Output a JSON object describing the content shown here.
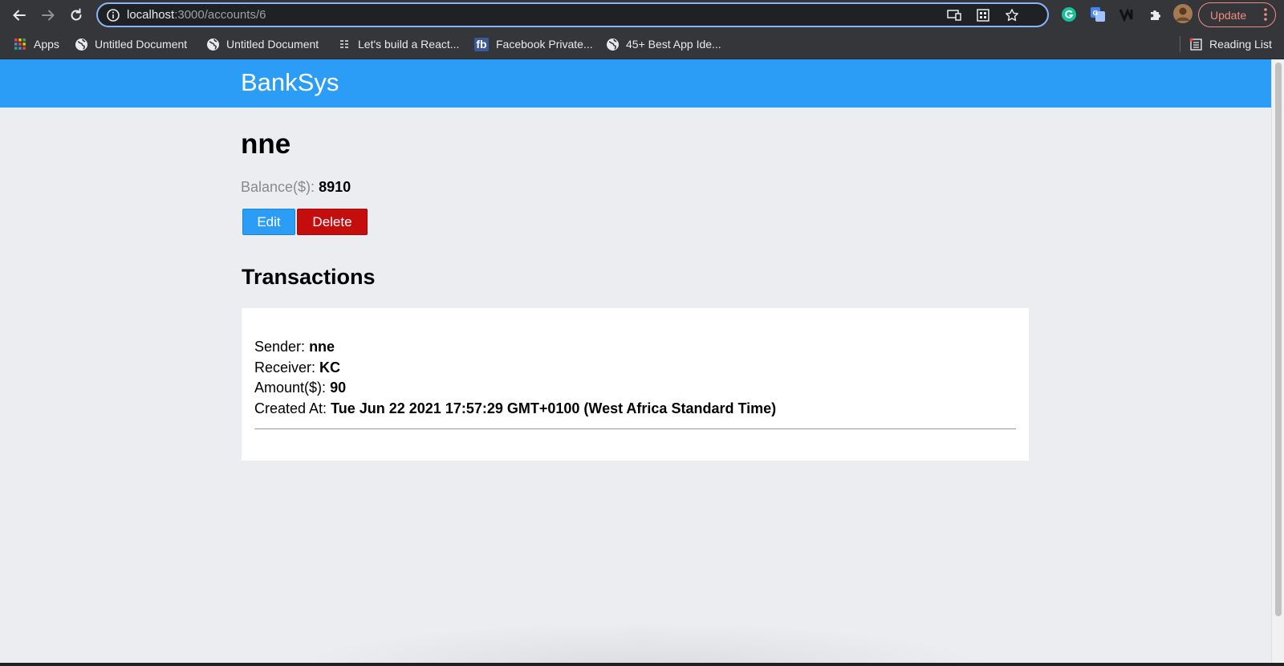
{
  "browser": {
    "url_host": "localhost",
    "url_rest": ":3000/accounts/6",
    "update_label": "Update",
    "bookmarks": [
      {
        "label": "Apps",
        "icon": "apps-grid-icon"
      },
      {
        "label": "Untitled Document",
        "icon": "globe-icon"
      },
      {
        "label": "Untitled Document",
        "icon": "globe-icon"
      },
      {
        "label": "Let's build a React...",
        "icon": "list-icon"
      },
      {
        "label": "Facebook Private...",
        "icon": "fb-icon"
      },
      {
        "label": "45+ Best App Ide...",
        "icon": "globe-icon"
      }
    ],
    "reading_list": "Reading List",
    "fb_glyph": "fb"
  },
  "app": {
    "brand": "BankSys",
    "brand_color": "#2b9df6"
  },
  "account": {
    "name": "nne",
    "balance_label": "Balance($):",
    "balance_value": "8910",
    "edit_label": "Edit",
    "delete_label": "Delete"
  },
  "transactions": {
    "title": "Transactions",
    "items": [
      {
        "sender_label": "Sender:",
        "sender": "nne",
        "receiver_label": "Receiver:",
        "receiver": "KC",
        "amount_label": "Amount($):",
        "amount": "90",
        "created_label": "Created At:",
        "created": "Tue Jun 22 2021 17:57:29 GMT+0100 (West Africa Standard Time)"
      }
    ]
  },
  "colors": {
    "edit": "#2b9df6",
    "delete": "#c40d0d",
    "page_bg": "#ebedf1"
  }
}
